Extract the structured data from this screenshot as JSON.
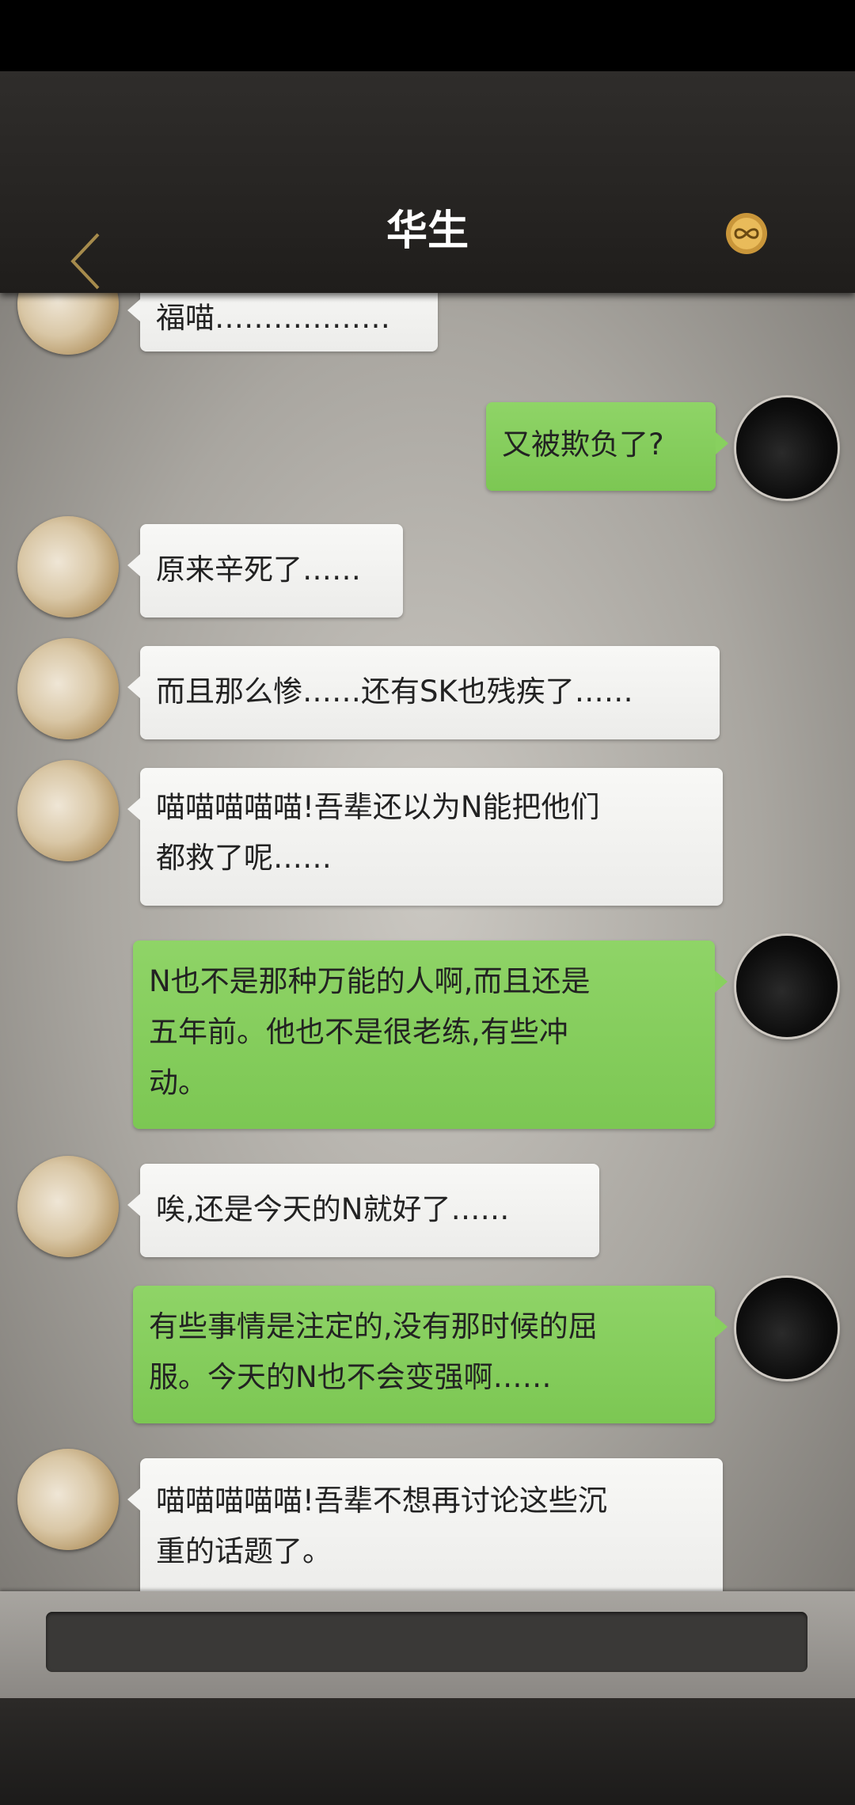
{
  "header": {
    "title": "华生"
  },
  "icons": {
    "back": "chevron-left-icon",
    "badge": "gold-infinity-badge-icon"
  },
  "colors": {
    "header_bg": "#2a2826",
    "my_bubble": "#84cb5b",
    "their_bubble": "#f2f2f0",
    "back_chevron": "#a68b4c"
  },
  "messages": [
    {
      "sender": "cat",
      "lines": [
        "福喵………………"
      ]
    },
    {
      "sender": "me",
      "lines": [
        "又被欺负了?"
      ]
    },
    {
      "sender": "cat",
      "lines": [
        "原来辛死了……"
      ]
    },
    {
      "sender": "cat",
      "lines": [
        "而且那么惨……还有SK也残疾了……"
      ]
    },
    {
      "sender": "cat",
      "lines": [
        "喵喵喵喵喵!吾辈还以为N能把他们",
        "都救了呢……"
      ]
    },
    {
      "sender": "me",
      "lines": [
        "N也不是那种万能的人啊,而且还是",
        "五年前。他也不是很老练,有些冲",
        "动。"
      ]
    },
    {
      "sender": "cat",
      "lines": [
        "唉,还是今天的N就好了……"
      ]
    },
    {
      "sender": "me",
      "lines": [
        "有些事情是注定的,没有那时候的屈",
        "服。今天的N也不会变强啊……"
      ]
    },
    {
      "sender": "cat",
      "lines": [
        "喵喵喵喵喵!吾辈不想再讨论这些沉",
        "重的话题了。"
      ]
    }
  ],
  "input": {
    "value": ""
  }
}
